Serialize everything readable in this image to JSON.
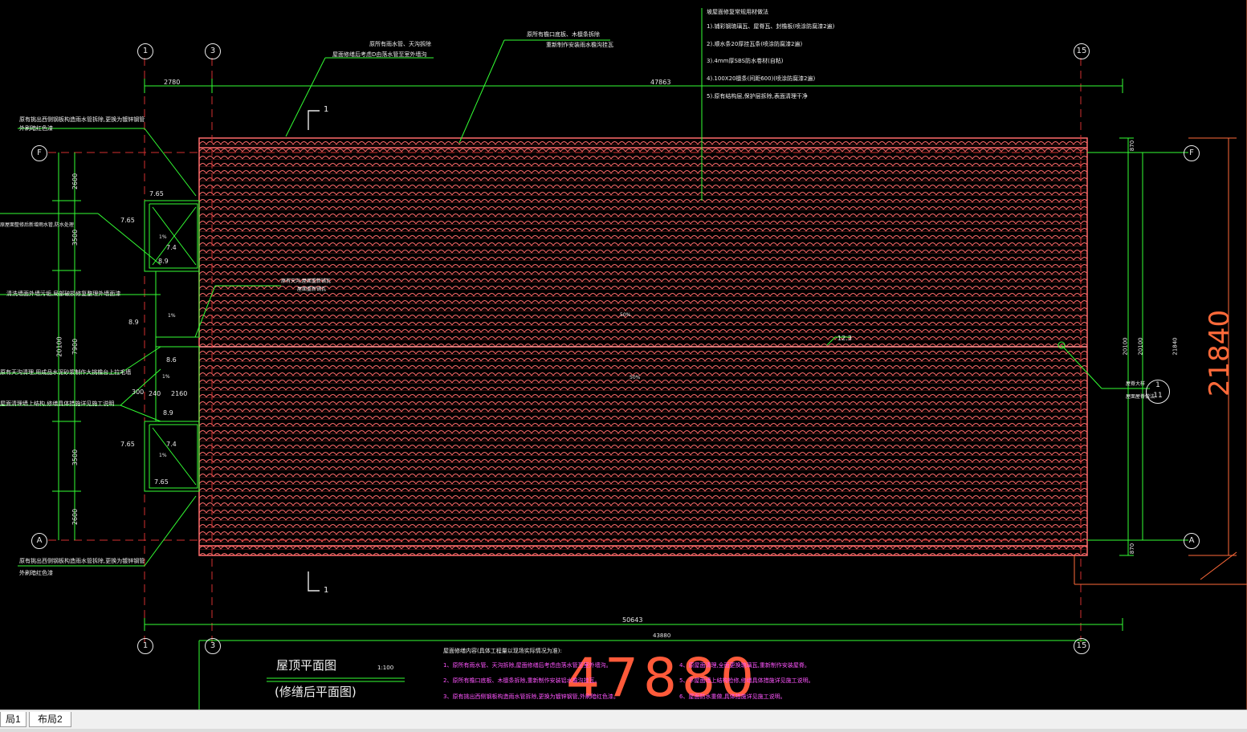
{
  "drawing": {
    "colors": {
      "background": "#000000",
      "green_lines": "#33ff33",
      "roof_tiles": "#ff6060",
      "dim_text": "#e8e8e8",
      "notes": "#ff55ff"
    },
    "axes": {
      "top": [
        "1",
        "3",
        "15"
      ],
      "side": [
        "F",
        "A"
      ],
      "section_ref_top": "1",
      "section_ref_bottom": "1",
      "detail_ref_top": "1",
      "detail_ref_bottom": "11"
    },
    "dimensions": {
      "top_left": "2780",
      "top_total": "47863",
      "bottom_total": "50643",
      "bottom_sub": "43880",
      "left_2600": "2600",
      "left_3500a": "3500",
      "left_20100": "20100",
      "left_7900": "7900",
      "left_300": "300",
      "left_3500b": "3500",
      "left_2600b": "2600",
      "right_870_top": "870",
      "right_870_bottom": "870",
      "right_20100a": "20100",
      "right_20100b": "20100",
      "right_21840_small": "21840",
      "right_21840_big": "21840",
      "bottom_big": "47880",
      "elev_765a": "7.65",
      "elev_765b": "7.65",
      "elev_765c": "7.65",
      "elev_765d": "7.65",
      "elev_74a": "7.4",
      "elev_74b": "7.4",
      "elev_89a": "8.9",
      "elev_89b": "8.9",
      "elev_89c": "8.9",
      "elev_86": "8.6",
      "elev_2160": "2160",
      "elev_240": "240",
      "slope_1": "1%",
      "slope_2": "1%",
      "slope_3": "1%",
      "slope_4": "1%",
      "ridge_elev": "12.3",
      "roof_upper_slope": "50%",
      "roof_lower_slope": "50%"
    },
    "annotations": {
      "top_left_note_1": "原所有雨水管、天沟拆除",
      "top_left_note_2": "屋面修缮后考虑D由落水管至室外墙沟",
      "top_mid_note_1": "原所有檐口底板、木檩条拆除",
      "top_mid_note_2": "重新制作安装雨水檐沟挂瓦",
      "left_note_1a": "原有挑出西侧钢板构造雨水管拆除,更换为镀锌钢管",
      "left_note_1b": "外刷暗红色漆",
      "left_note_2": "原屋面整修后新增雨水管,防水处理",
      "left_note_3": "清洗墙面外墙污垢,局部破损修复整理外墙面漆",
      "left_note_4": "原有天沟清理,用成品水泥砂浆制作大挑檐台上拉毛墙",
      "left_note_5": "屋面清理墙上结构,修缮具体措施详见施工说明",
      "left_note_6a": "原有挑出西侧钢板构造雨水管拆除,更换为镀锌钢管",
      "left_note_6b": "外刷暗红色漆",
      "center_note_1": "原有天沟,屋面重新铺瓦",
      "center_note_2": "屋面重新铺瓦",
      "right_note_1": "屋脊大样",
      "right_note_2": "屋面屋脊做法"
    },
    "spec_list": {
      "title": "坡屋面修复常规用材做法",
      "items": [
        "1).铺彩钢琉璃瓦、屋脊瓦、封檐板(喷涂防腐漆2遍)",
        "2).顺水条20厚挂瓦条(喷涂防腐漆2遍)",
        "3).4mm厚SBS防水卷材(自粘)",
        "4).100X20檩条(间距600)(喷涂防腐漆2遍)",
        "5).原有结构层,保护层拆除,表面清理干净"
      ]
    },
    "titles": {
      "main_title": "屋顶平面图",
      "scale": "1:100",
      "subtitle": "(修缮后平面图)"
    },
    "notes": {
      "heading": "屋面修缮内容(具体工程量以现场实际情况为准):",
      "left": [
        "1、原所有雨水管、天沟拆除,屋面修缮后考虑由落水管至室外墙沟。",
        "2、原所有檐口底板、木檩条拆除,重新制作安装铝水檐沟挂瓦。",
        "3、原有挑出西侧钢板构造雨水管拆除,更换为镀锌钢管,外刷暗红色漆。"
      ],
      "right": [
        "4、原屋面清理,全面更换琉璃瓦,重新制作安装屋脊。",
        "5、平屋面墙上结构检修,修缮具体措施详见施工说明。",
        "6、屋面防水重做,具体措施详见施工说明。"
      ]
    }
  },
  "layout_tabs": [
    "局1",
    "布局2"
  ]
}
